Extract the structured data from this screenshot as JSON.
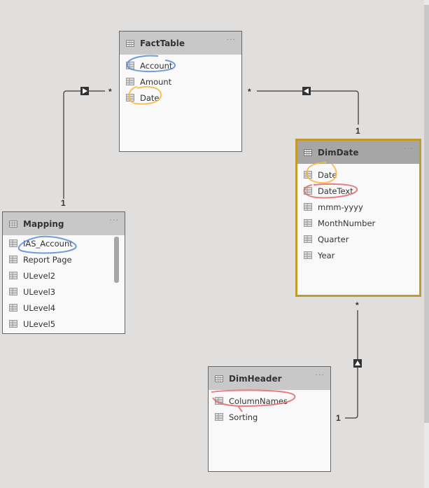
{
  "colors": {
    "canvas_bg": "#e0dfdd",
    "card_bg": "#f9f9f9",
    "header_bg": "#c8c8c8",
    "selected_header_bg": "#a6a6a6",
    "selected_border": "#c19c2c",
    "annotation_blue": "#5b8bd9",
    "annotation_orange": "#f5b942",
    "annotation_red": "#e26b6b"
  },
  "tables": {
    "fact": {
      "title": "FactTable",
      "more": "···",
      "fields": [
        "Account",
        "Amount",
        "Date"
      ]
    },
    "dimdate": {
      "title": "DimDate",
      "more": "···",
      "selected": true,
      "fields": [
        "Date",
        "DateText",
        "mmm-yyyy",
        "MonthNumber",
        "Quarter",
        "Year"
      ]
    },
    "mapping": {
      "title": "Mapping",
      "more": "···",
      "fields": [
        "IAS_Account",
        "Report Page",
        "ULevel2",
        "ULevel3",
        "ULevel4",
        "ULevel5"
      ]
    },
    "dimheader": {
      "title": "DimHeader",
      "more": "···",
      "fields": [
        "ColumnNames",
        "Sorting"
      ]
    }
  },
  "relationships": [
    {
      "from": "Mapping",
      "to": "FactTable",
      "from_cardinality": "1",
      "to_cardinality": "*",
      "filter_direction": "right"
    },
    {
      "from": "DimDate",
      "to": "FactTable",
      "from_cardinality": "1",
      "to_cardinality": "*",
      "filter_direction": "left"
    },
    {
      "from": "DimHeader",
      "to": "DimDate",
      "from_cardinality": "1",
      "to_cardinality": "*",
      "filter_direction": "up"
    }
  ],
  "cardinality_labels": {
    "mapping_fact_one": "1",
    "mapping_fact_many": "*",
    "dimdate_fact_one": "1",
    "dimdate_fact_many": "*",
    "dimheader_dimdate_one": "1",
    "dimheader_dimdate_many": "*"
  }
}
